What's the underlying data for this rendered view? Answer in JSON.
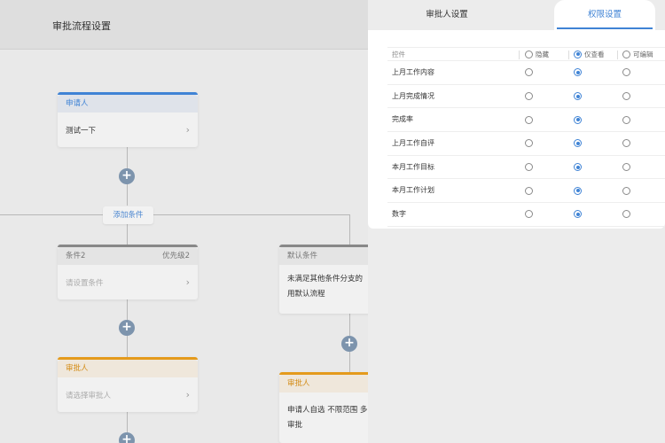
{
  "page": {
    "title": "审批流程设置"
  },
  "flow": {
    "applicant": {
      "header": "申请人",
      "value": "测试一下"
    },
    "add_condition_label": "添加条件",
    "condition2": {
      "title": "条件2",
      "priority": "优先级2",
      "placeholder": "请设置条件"
    },
    "default_condition": {
      "title": "默认条件",
      "desc_line1": "未满足其他条件分支的",
      "desc_line2": "用默认流程"
    },
    "approver_left": {
      "header": "审批人",
      "placeholder": "请选择审批人"
    },
    "approver_right": {
      "header": "审批人",
      "desc_line1": "申请人自选 不限范围 多",
      "desc_line2": "审批"
    }
  },
  "drawer": {
    "tabs": [
      {
        "label": "审批人设置",
        "active": false
      },
      {
        "label": "权限设置",
        "active": true
      }
    ],
    "columns": {
      "control": "控件",
      "hide": "隐藏",
      "view_only": "仅查看",
      "editable": "可编辑"
    },
    "header_selected": "view_only",
    "rows": [
      {
        "name": "上月工作内容",
        "selected": "view_only"
      },
      {
        "name": "上月完成情况",
        "selected": "view_only"
      },
      {
        "name": "完成率",
        "selected": "view_only"
      },
      {
        "name": "上月工作自评",
        "selected": "view_only"
      },
      {
        "name": "本月工作目标",
        "selected": "view_only"
      },
      {
        "name": "本月工作计划",
        "selected": "view_only"
      },
      {
        "name": "数字",
        "selected": "view_only"
      }
    ]
  },
  "colors": {
    "accent": "#3f83d5",
    "approver": "#e49a1c",
    "plus": "#7d94ad"
  }
}
